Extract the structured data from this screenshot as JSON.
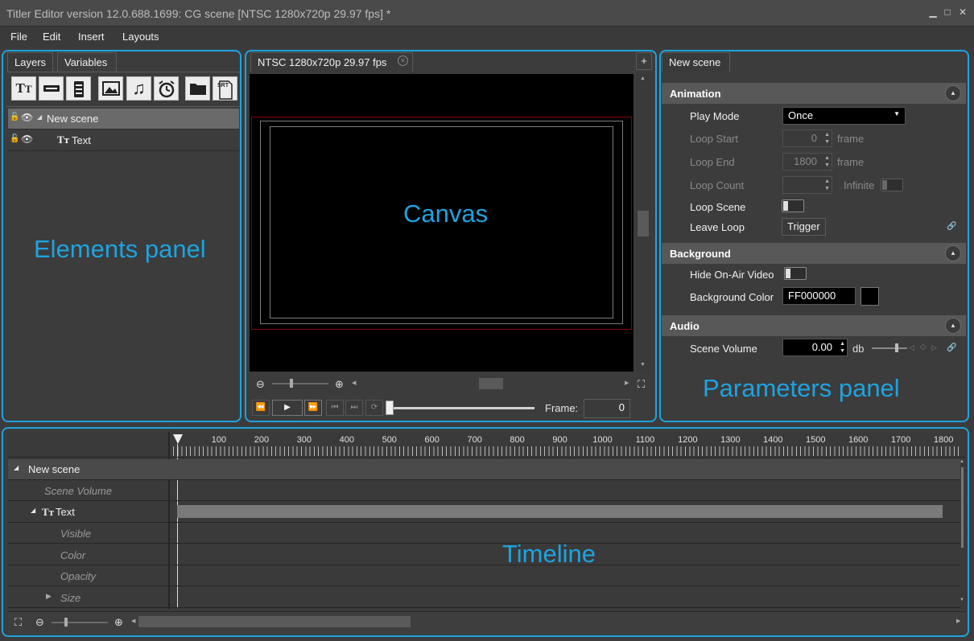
{
  "window": {
    "title": "Titler Editor version 12.0.688.1699: CG scene [NTSC 1280x720p 29.97 fps] *"
  },
  "menu": [
    "File",
    "Edit",
    "Insert",
    "Layouts"
  ],
  "elements_panel": {
    "tabs": [
      "Layers",
      "Variables"
    ],
    "label": "Elements panel",
    "tools": [
      "text-tool",
      "ticker-tool",
      "roll-tool",
      "image-tool",
      "audio-tool",
      "clock-tool",
      "open-folder-tool",
      "srt-tool"
    ],
    "srt_label": "SRT",
    "layers": [
      {
        "name": "New scene",
        "selected": true
      },
      {
        "name": "Text",
        "selected": false
      }
    ]
  },
  "canvas_panel": {
    "tab": "NTSC 1280x720p 29.97 fps",
    "label": "Canvas",
    "frame_label": "Frame:",
    "frame_value": "0"
  },
  "parameters_panel": {
    "tab": "New scene",
    "label": "Parameters panel",
    "animation": {
      "header": "Animation",
      "play_mode_label": "Play Mode",
      "play_mode_value": "Once",
      "loop_start_label": "Loop Start",
      "loop_start_value": "0",
      "loop_end_label": "Loop End",
      "loop_end_value": "1800",
      "frame_unit": "frame",
      "loop_count_label": "Loop Count",
      "infinite_label": "Infinite",
      "loop_scene_label": "Loop Scene",
      "leave_loop_label": "Leave Loop",
      "trigger_label": "Trigger"
    },
    "background": {
      "header": "Background",
      "hide_video_label": "Hide On-Air Video",
      "bg_color_label": "Background Color",
      "bg_color_value": "FF000000"
    },
    "audio": {
      "header": "Audio",
      "volume_label": "Scene Volume",
      "volume_value": "0.00",
      "volume_unit": "db"
    }
  },
  "timeline": {
    "label": "Timeline",
    "ruler": [
      "100",
      "200",
      "300",
      "400",
      "500",
      "600",
      "700",
      "800",
      "900",
      "1000",
      "1100",
      "1200",
      "1300",
      "1400",
      "1500",
      "1600",
      "1700",
      "1800"
    ],
    "rows": [
      {
        "label": "New scene",
        "kind": "group"
      },
      {
        "label": "Scene Volume",
        "kind": "param"
      },
      {
        "label": "Text",
        "kind": "layer"
      },
      {
        "label": "Visible",
        "kind": "param"
      },
      {
        "label": "Color",
        "kind": "param"
      },
      {
        "label": "Opacity",
        "kind": "param"
      },
      {
        "label": "Size",
        "kind": "param"
      }
    ]
  },
  "colors": {
    "accent": "#1ea3e0",
    "canvas_safe_frame": "#8b0000"
  }
}
